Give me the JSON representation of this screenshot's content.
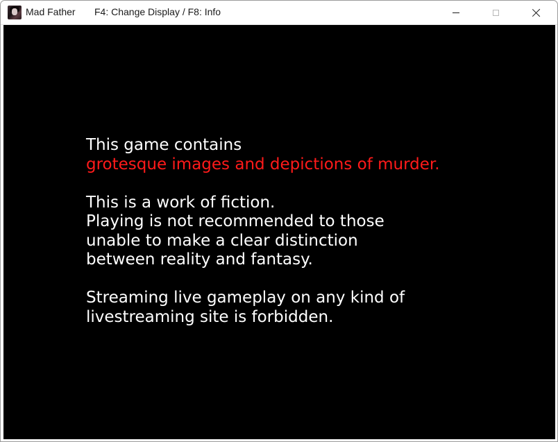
{
  "window": {
    "app_title": "Mad Father",
    "title_hint": "F4: Change Display / F8: Info",
    "icon": "mad-father-app-icon",
    "controls": {
      "minimize": "minimize-icon",
      "maximize": "maximize-icon",
      "close": "close-icon"
    }
  },
  "warning": {
    "line1": "This game contains",
    "line2": "grotesque images and depictions of murder.",
    "line3": "This is a work of fiction.",
    "line4": "Playing is not recommended to those",
    "line5": "unable to make a clear distinction",
    "line6": "between reality and fantasy.",
    "line7": "Streaming live gameplay on any kind of",
    "line8": "livestreaming site is forbidden."
  },
  "colors": {
    "background": "#000000",
    "text": "#ffffff",
    "highlight": "#ff1a1a"
  }
}
